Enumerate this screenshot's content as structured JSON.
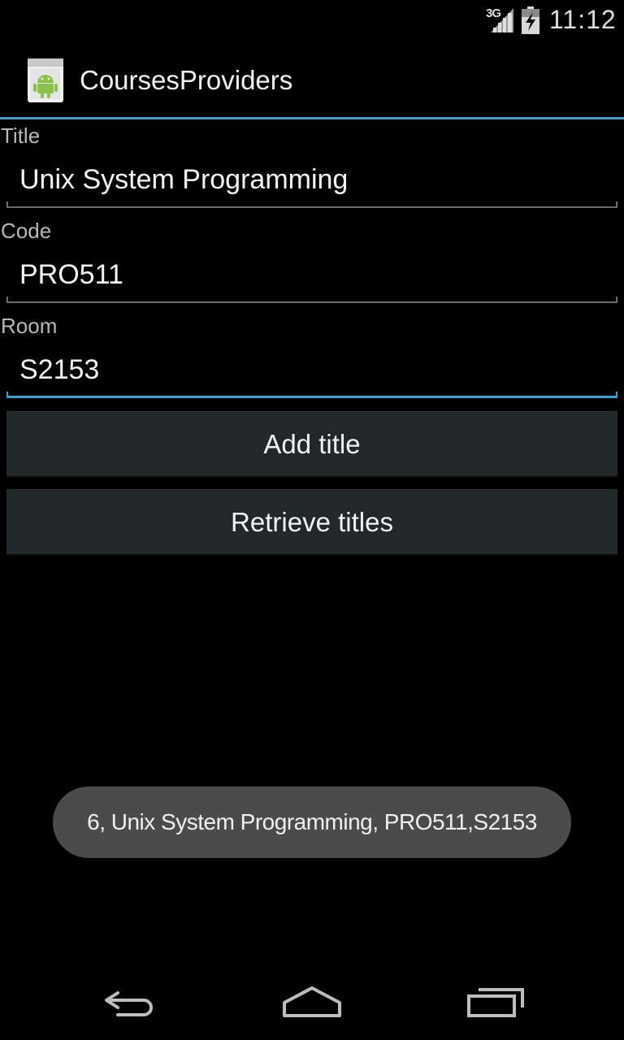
{
  "status_bar": {
    "network": "3G",
    "time": "11:12"
  },
  "action_bar": {
    "app_title": "CoursesProviders",
    "app_icon": "android-icon"
  },
  "form": {
    "title": {
      "label": "Title",
      "value": "Unix System Programming"
    },
    "code": {
      "label": "Code",
      "value": "PRO511"
    },
    "room": {
      "label": "Room",
      "value": "S2153"
    }
  },
  "buttons": {
    "add_label": "Add title",
    "retrieve_label": "Retrieve titles"
  },
  "toast": {
    "message": "6, Unix System Programming, PRO511,S2153"
  },
  "nav_bar": {
    "icons": [
      "back-icon",
      "home-icon",
      "recents-icon"
    ]
  },
  "colors": {
    "accent": "#33a3d4",
    "background": "#000000",
    "button": "#212829",
    "toast": "#4a4b4a"
  }
}
